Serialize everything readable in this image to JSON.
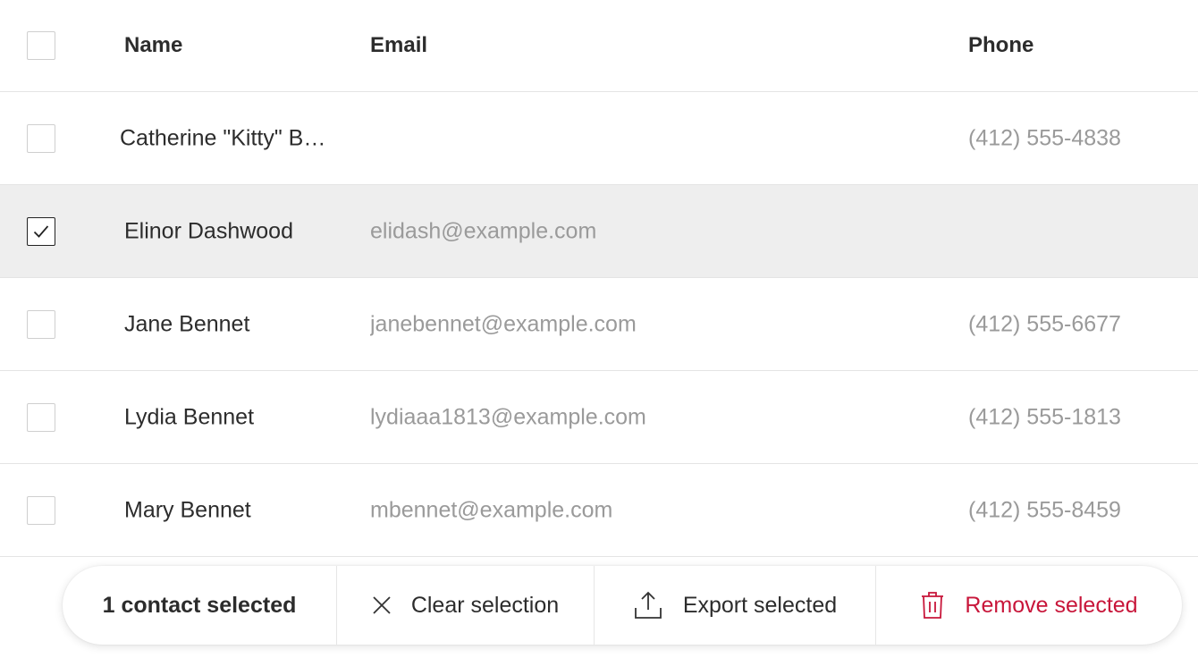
{
  "table": {
    "headers": {
      "name": "Name",
      "email": "Email",
      "phone": "Phone"
    },
    "rows": [
      {
        "name": "Catherine \"Kitty\" Bennet",
        "email": "",
        "phone": "(412) 555-4838",
        "checked": false
      },
      {
        "name": "Elinor Dashwood",
        "email": "elidash@example.com",
        "phone": "",
        "checked": true
      },
      {
        "name": "Jane Bennet",
        "email": "janebennet@example.com",
        "phone": "(412) 555-6677",
        "checked": false
      },
      {
        "name": "Lydia Bennet",
        "email": "lydiaaa1813@example.com",
        "phone": "(412) 555-1813",
        "checked": false
      },
      {
        "name": "Mary Bennet",
        "email": "mbennet@example.com",
        "phone": "(412) 555-8459",
        "checked": false
      }
    ]
  },
  "action_bar": {
    "selection_count": "1 contact selected",
    "clear_label": "Clear selection",
    "export_label": "Export selected",
    "remove_label": "Remove selected",
    "icons": {
      "clear": "close-icon",
      "export": "upload-icon",
      "remove": "trash-icon"
    }
  },
  "colors": {
    "selected_row_bg": "#eeeeee",
    "danger": "#c8163a",
    "muted_text": "#9a9a9a"
  }
}
